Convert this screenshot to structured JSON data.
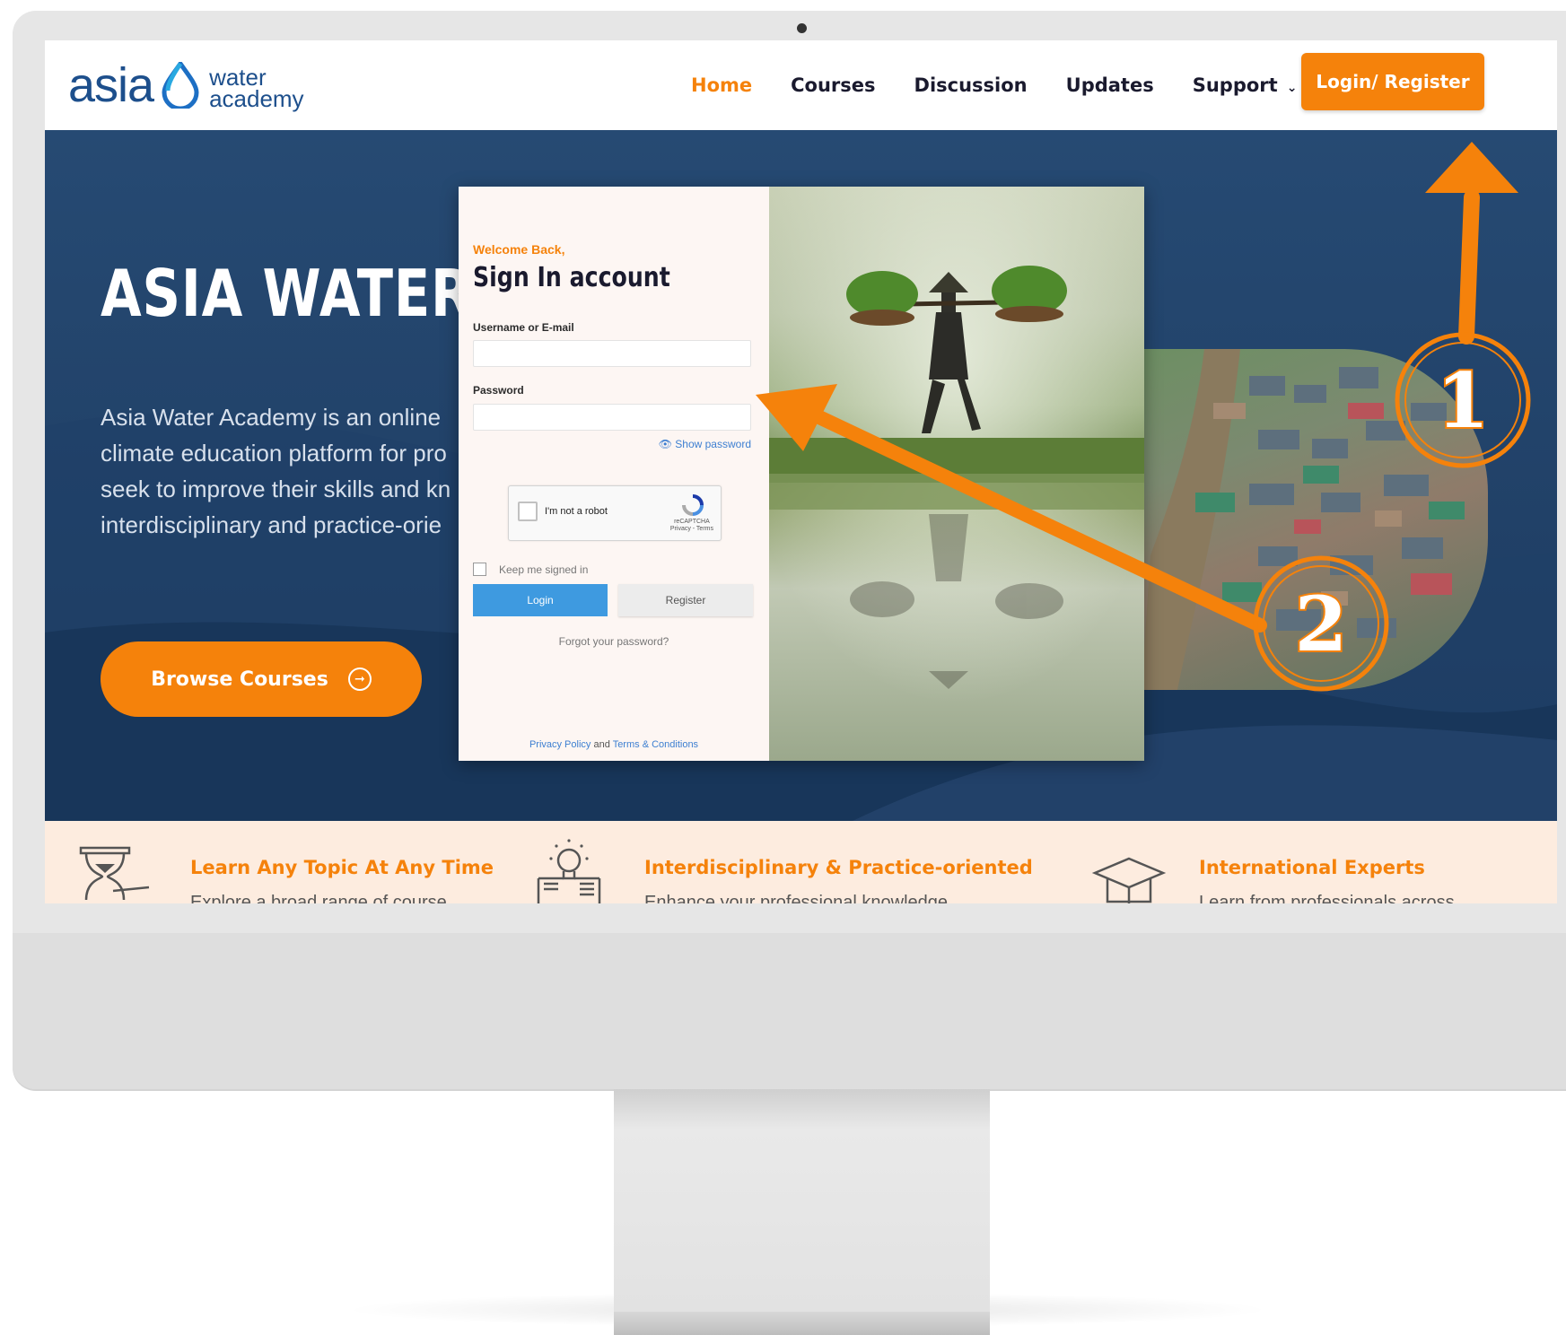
{
  "nav": {
    "logo": {
      "asia": "asia",
      "water": "water",
      "academy": "academy"
    },
    "links": [
      "Home",
      "Courses",
      "Discussion",
      "Updates",
      "Support"
    ],
    "active_link": "Home",
    "login_register": "Login/ Register"
  },
  "hero": {
    "title": "ASIA WATER ACADEMY",
    "description": [
      "Asia Water Academy is an online",
      "climate education platform for pro",
      "seek to improve their skills and kn",
      "interdisciplinary and practice-orie"
    ],
    "browse_button": "Browse Courses"
  },
  "signin": {
    "welcome": "Welcome Back,",
    "title": "Sign In account",
    "username_label": "Username or E-mail",
    "password_label": "Password",
    "show_password": "Show password",
    "captcha_text": "I'm not a robot",
    "captcha_brand": "reCAPTCHA",
    "captcha_links": "Privacy - Terms",
    "keep_signed_in": "Keep me signed in",
    "login_button": "Login",
    "register_button": "Register",
    "forgot_password": "Forgot your password?",
    "privacy_policy": "Privacy Policy",
    "and": "and",
    "terms": "Terms & Conditions"
  },
  "features": [
    {
      "title": "Learn Any Topic At Any Time",
      "desc": "Explore a broad range of course",
      "icon": "hourglass-icon"
    },
    {
      "title": "Interdisciplinary & Practice-oriented",
      "desc": "Enhance your professional knowledge",
      "icon": "lightbulb-book-icon"
    },
    {
      "title": "International Experts",
      "desc": "Learn from professionals across",
      "icon": "graduation-cap-icon"
    }
  ],
  "annotations": {
    "step1": "1",
    "step2": "2"
  },
  "colors": {
    "accent": "#f5820b",
    "navy": "#1d3a5f",
    "link_blue": "#3d7fd1",
    "login_blue": "#3e9ae0"
  }
}
